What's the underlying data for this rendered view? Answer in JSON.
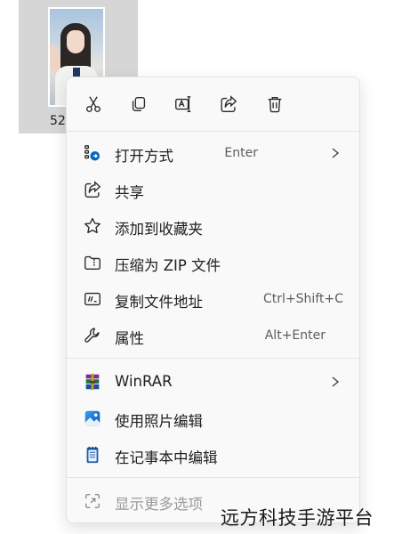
{
  "file": {
    "name": "52"
  },
  "quick_actions": [
    {
      "icon": "cut-icon"
    },
    {
      "icon": "copy-icon"
    },
    {
      "icon": "rename-icon"
    },
    {
      "icon": "share-icon"
    },
    {
      "icon": "delete-icon"
    }
  ],
  "menu": {
    "items": [
      {
        "label": "打开方式",
        "shortcut": "Enter",
        "icon": "open-with-icon",
        "submenu": true
      },
      {
        "label": "共享",
        "icon": "share-icon"
      },
      {
        "label": "添加到收藏夹",
        "icon": "star-icon"
      },
      {
        "label": "压缩为 ZIP 文件",
        "icon": "zip-folder-icon"
      },
      {
        "label": "复制文件地址",
        "shortcut": "Ctrl+Shift+C",
        "icon": "copy-path-icon"
      },
      {
        "label": "属性",
        "shortcut": "Alt+Enter",
        "icon": "wrench-icon"
      }
    ],
    "extensions": [
      {
        "label": "WinRAR",
        "icon": "winrar-icon",
        "submenu": true
      },
      {
        "label": "使用照片编辑",
        "icon": "photos-icon"
      },
      {
        "label": "在记事本中编辑",
        "icon": "notepad-icon"
      }
    ],
    "more": {
      "label": "显示更多选项",
      "icon": "show-more-icon"
    }
  },
  "watermark": "远方科技手游平台",
  "colors": {
    "menu_bg": "#f9f9f9",
    "selection_bg": "#d6d6d6",
    "accent": "#0067c0"
  }
}
